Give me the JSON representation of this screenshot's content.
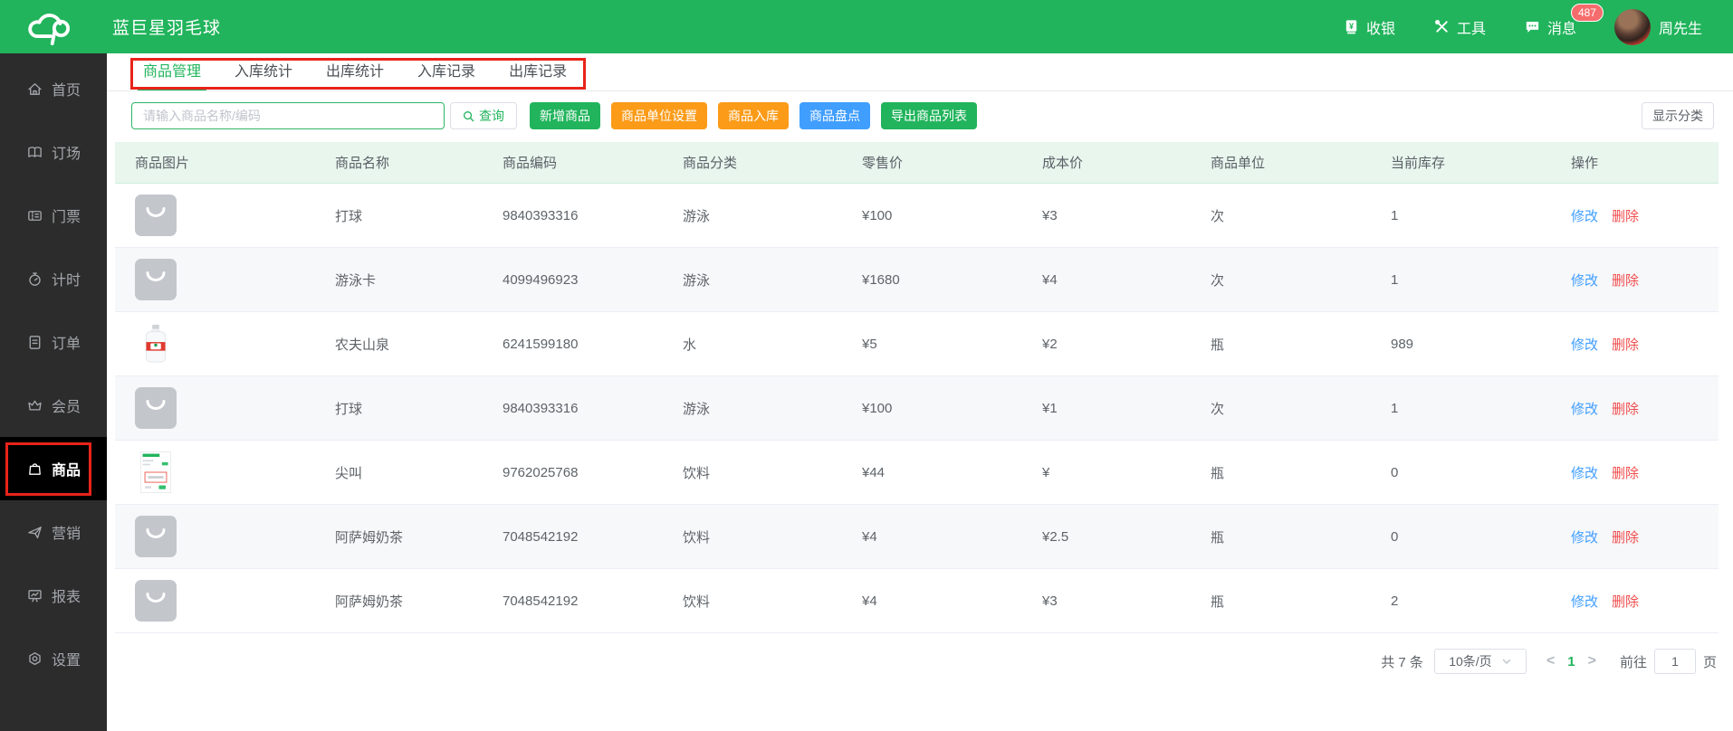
{
  "header": {
    "brand": "蓝巨星羽毛球",
    "cashier": "收银",
    "tools": "工具",
    "messages": "消息",
    "badge": "487",
    "user": "周先生"
  },
  "sidebar": {
    "items": [
      {
        "key": "home",
        "icon": "home-icon",
        "label": "首页",
        "active": false
      },
      {
        "key": "booking",
        "icon": "booking-icon",
        "label": "订场",
        "active": false
      },
      {
        "key": "ticket",
        "icon": "ticket-icon",
        "label": "门票",
        "active": false
      },
      {
        "key": "timer",
        "icon": "stopwatch-icon",
        "label": "计时",
        "active": false
      },
      {
        "key": "orders",
        "icon": "document-icon",
        "label": "订单",
        "active": false
      },
      {
        "key": "member",
        "icon": "crown-icon",
        "label": "会员",
        "active": false
      },
      {
        "key": "goods",
        "icon": "bag-icon",
        "label": "商品",
        "active": true
      },
      {
        "key": "marketing",
        "icon": "paper-plane-icon",
        "label": "营销",
        "active": false
      },
      {
        "key": "report",
        "icon": "chart-board-icon",
        "label": "报表",
        "active": false
      },
      {
        "key": "settings",
        "icon": "gear-icon",
        "label": "设置",
        "active": false
      }
    ]
  },
  "tabs": [
    {
      "key": "goods-management",
      "label": "商品管理",
      "active": true
    },
    {
      "key": "inbound-stats",
      "label": "入库统计",
      "active": false
    },
    {
      "key": "outbound-stats",
      "label": "出库统计",
      "active": false
    },
    {
      "key": "inbound-records",
      "label": "入库记录",
      "active": false
    },
    {
      "key": "outbound-records",
      "label": "出库记录",
      "active": false
    }
  ],
  "toolbar": {
    "search_placeholder": "请输入商品名称/编码",
    "search_button": "查询",
    "buttons": [
      {
        "name": "add-product-button",
        "label": "新增商品",
        "color": "green"
      },
      {
        "name": "unit-settings-button",
        "label": "商品单位设置",
        "color": "orange"
      },
      {
        "name": "stock-in-button",
        "label": "商品入库",
        "color": "orange"
      },
      {
        "name": "stocktake-button",
        "label": "商品盘点",
        "color": "blue"
      },
      {
        "name": "export-products-button",
        "label": "导出商品列表",
        "color": "green"
      }
    ],
    "show_category": "显示分类"
  },
  "table": {
    "columns": [
      "商品图片",
      "商品名称",
      "商品编码",
      "商品分类",
      "零售价",
      "成本价",
      "商品单位",
      "当前库存",
      "操作"
    ],
    "column_keys": [
      "image",
      "name",
      "code",
      "category",
      "price",
      "cost",
      "unit",
      "stock",
      "actions"
    ],
    "rows": [
      {
        "image": "bag-placeholder",
        "name": "打球",
        "code": "9840393316",
        "category": "游泳",
        "price": "¥100",
        "cost": "¥3",
        "unit": "次",
        "stock": "1"
      },
      {
        "image": "bag-placeholder",
        "name": "游泳卡",
        "code": "4099496923",
        "category": "游泳",
        "price": "¥1680",
        "cost": "¥4",
        "unit": "次",
        "stock": "1"
      },
      {
        "image": "water-bottle-photo",
        "name": "农夫山泉",
        "code": "6241599180",
        "category": "水",
        "price": "¥5",
        "cost": "¥2",
        "unit": "瓶",
        "stock": "989"
      },
      {
        "image": "bag-placeholder",
        "name": "打球",
        "code": "9840393316",
        "category": "游泳",
        "price": "¥100",
        "cost": "¥1",
        "unit": "次",
        "stock": "1"
      },
      {
        "image": "form-screenshot-thumb",
        "name": "尖叫",
        "code": "9762025768",
        "category": "饮料",
        "price": "¥44",
        "cost": "¥",
        "unit": "瓶",
        "stock": "0"
      },
      {
        "image": "bag-placeholder",
        "name": "阿萨姆奶茶",
        "code": "7048542192",
        "category": "饮料",
        "price": "¥4",
        "cost": "¥2.5",
        "unit": "瓶",
        "stock": "0"
      },
      {
        "image": "bag-placeholder",
        "name": "阿萨姆奶茶",
        "code": "7048542192",
        "category": "饮料",
        "price": "¥4",
        "cost": "¥3",
        "unit": "瓶",
        "stock": "2"
      }
    ],
    "actions": {
      "edit": "修改",
      "delete": "删除"
    }
  },
  "pagination": {
    "total": "共 7 条",
    "page_size": "10条/页",
    "current": "1",
    "goto_label": "前往",
    "goto_value": "1",
    "page_suffix": "页"
  },
  "colors": {
    "brand_green": "#21b45c",
    "orange": "#fb9b18",
    "blue": "#409eff",
    "annotation_red": "#e8231a",
    "delete_red": "#f04c4c",
    "table_header_bg": "#e8f6ee",
    "sidebar_bg": "#2c2c2c",
    "badge_red": "#f56c6c"
  }
}
